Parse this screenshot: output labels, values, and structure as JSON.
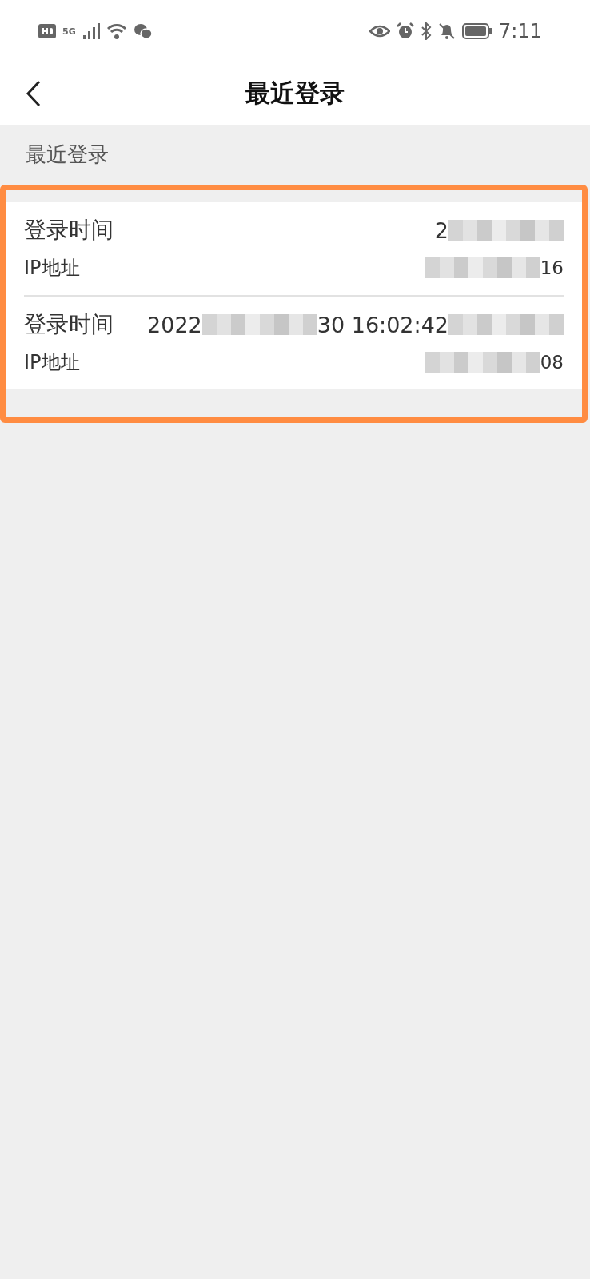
{
  "status_bar": {
    "time": "7:11",
    "network": "5G"
  },
  "header": {
    "title": "最近登录"
  },
  "section": {
    "title": "最近登录"
  },
  "logins": [
    {
      "time_label": "登录时间",
      "time_parts": [
        "2"
      ],
      "ip_label": "IP地址",
      "ip_parts": [
        "16"
      ]
    },
    {
      "time_label": "登录时间",
      "time_parts": [
        "2022",
        "30 16:02:42"
      ],
      "ip_label": "IP地址",
      "ip_parts": [
        "08"
      ]
    }
  ],
  "highlight": {
    "kind": "frame"
  }
}
